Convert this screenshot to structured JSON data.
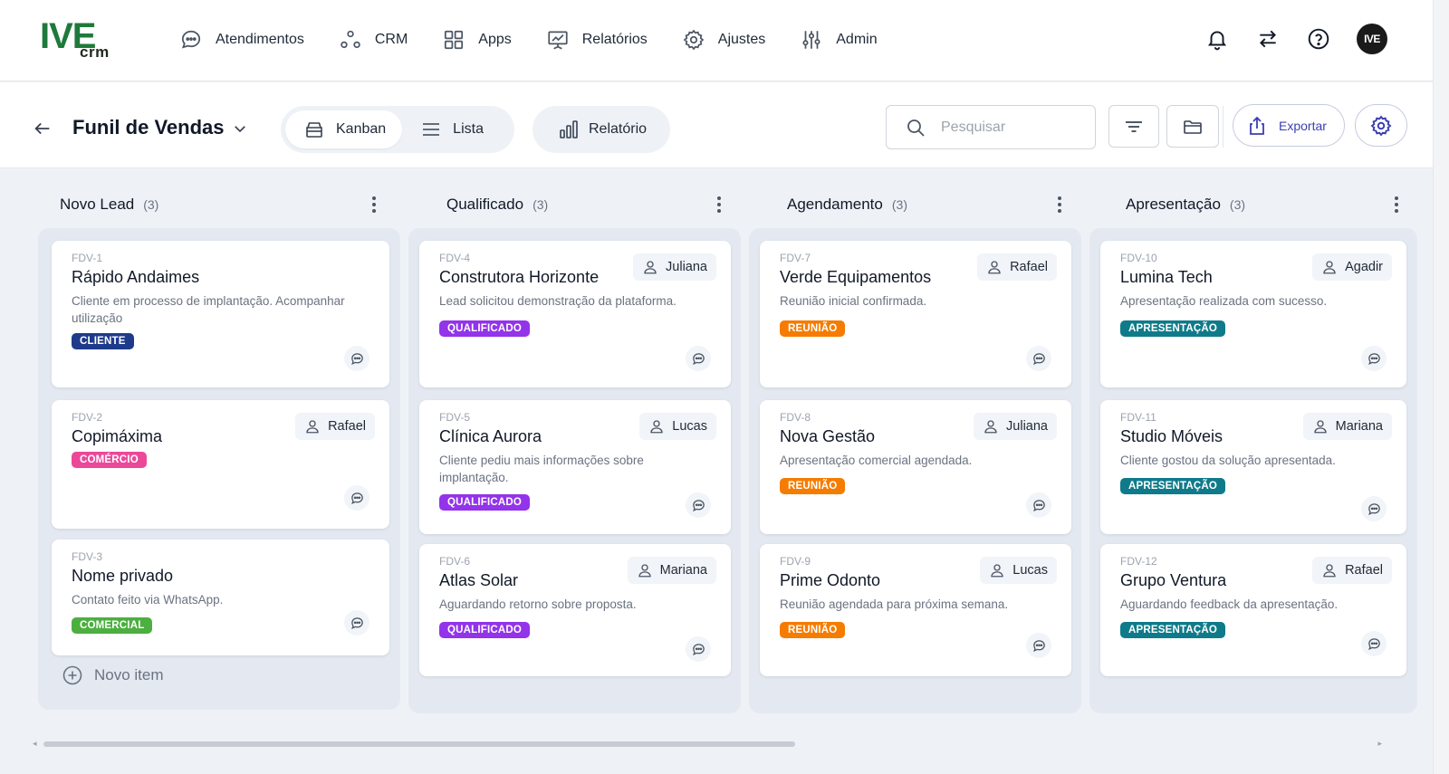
{
  "app": {
    "logo_text": "IVE",
    "logo_sub": "crm",
    "avatar_text": "IVE"
  },
  "nav": [
    {
      "label": "Atendimentos",
      "icon": "chat-bubble-icon"
    },
    {
      "label": "CRM",
      "icon": "nodes-icon"
    },
    {
      "label": "Apps",
      "icon": "grid-icon"
    },
    {
      "label": "Relatórios",
      "icon": "presentation-chart-icon"
    },
    {
      "label": "Ajustes",
      "icon": "gear-icon"
    },
    {
      "label": "Admin",
      "icon": "sliders-icon"
    }
  ],
  "toolbar": {
    "title": "Funil de Vendas",
    "view_kanban": "Kanban",
    "view_lista": "Lista",
    "report": "Relatório",
    "search_placeholder": "Pesquisar",
    "export": "Exportar"
  },
  "columns": [
    {
      "title": "Novo Lead",
      "count": "(3)",
      "cards": [
        {
          "id": "FDV-1",
          "title": "Rápido Andaimes",
          "desc": "Cliente em processo de implantação. Acompanhar utilização",
          "tag": "CLIENTE",
          "tag_color": "#1e3a8a",
          "owner": ""
        },
        {
          "id": "FDV-2",
          "title": "Copimáxima",
          "desc": "",
          "tag": "COMÉRCIO",
          "tag_color": "#ec4899",
          "owner": "Rafael"
        },
        {
          "id": "FDV-3",
          "title": "Nome privado",
          "desc": "Contato feito via WhatsApp.",
          "tag": "COMERCIAL",
          "tag_color": "#4caf3f",
          "owner": ""
        }
      ],
      "new_item": "Novo item"
    },
    {
      "title": "Qualificado",
      "count": "(3)",
      "cards": [
        {
          "id": "FDV-4",
          "title": "Construtora Horizonte",
          "desc": "Lead solicitou demonstração da plataforma.",
          "tag": "QUALIFICADO",
          "tag_color": "#9333ea",
          "owner": "Juliana"
        },
        {
          "id": "FDV-5",
          "title": "Clínica Aurora",
          "desc": "Cliente pediu mais informações sobre implantação.",
          "tag": "QUALIFICADO",
          "tag_color": "#9333ea",
          "owner": "Lucas"
        },
        {
          "id": "FDV-6",
          "title": "Atlas Solar",
          "desc": "Aguardando retorno sobre proposta.",
          "tag": "QUALIFICADO",
          "tag_color": "#9333ea",
          "owner": "Mariana"
        }
      ]
    },
    {
      "title": "Agendamento",
      "count": "(3)",
      "cards": [
        {
          "id": "FDV-7",
          "title": "Verde Equipamentos",
          "desc": "Reunião inicial confirmada.",
          "tag": "REUNIÃO",
          "tag_color": "#f57c00",
          "owner": "Rafael"
        },
        {
          "id": "FDV-8",
          "title": "Nova Gestão",
          "desc": "Apresentação comercial agendada.",
          "tag": "REUNIÃO",
          "tag_color": "#f57c00",
          "owner": "Juliana"
        },
        {
          "id": "FDV-9",
          "title": "Prime Odonto",
          "desc": "Reunião agendada para próxima semana.",
          "tag": "REUNIÃO",
          "tag_color": "#f57c00",
          "owner": "Lucas"
        }
      ]
    },
    {
      "title": "Apresentação",
      "count": "(3)",
      "cards": [
        {
          "id": "FDV-10",
          "title": "Lumina Tech",
          "desc": "Apresentação realizada com sucesso.",
          "tag": "APRESENTAÇÃO",
          "tag_color": "#0f7b8a",
          "owner": "Agadir"
        },
        {
          "id": "FDV-11",
          "title": "Studio Móveis",
          "desc": "Cliente gostou da solução apresentada.",
          "tag": "APRESENTAÇÃO",
          "tag_color": "#0f7b8a",
          "owner": "Mariana"
        },
        {
          "id": "FDV-12",
          "title": "Grupo Ventura",
          "desc": "Aguardando feedback da apresentação.",
          "tag": "APRESENTAÇÃO",
          "tag_color": "#0f7b8a",
          "owner": "Rafael"
        }
      ]
    }
  ]
}
